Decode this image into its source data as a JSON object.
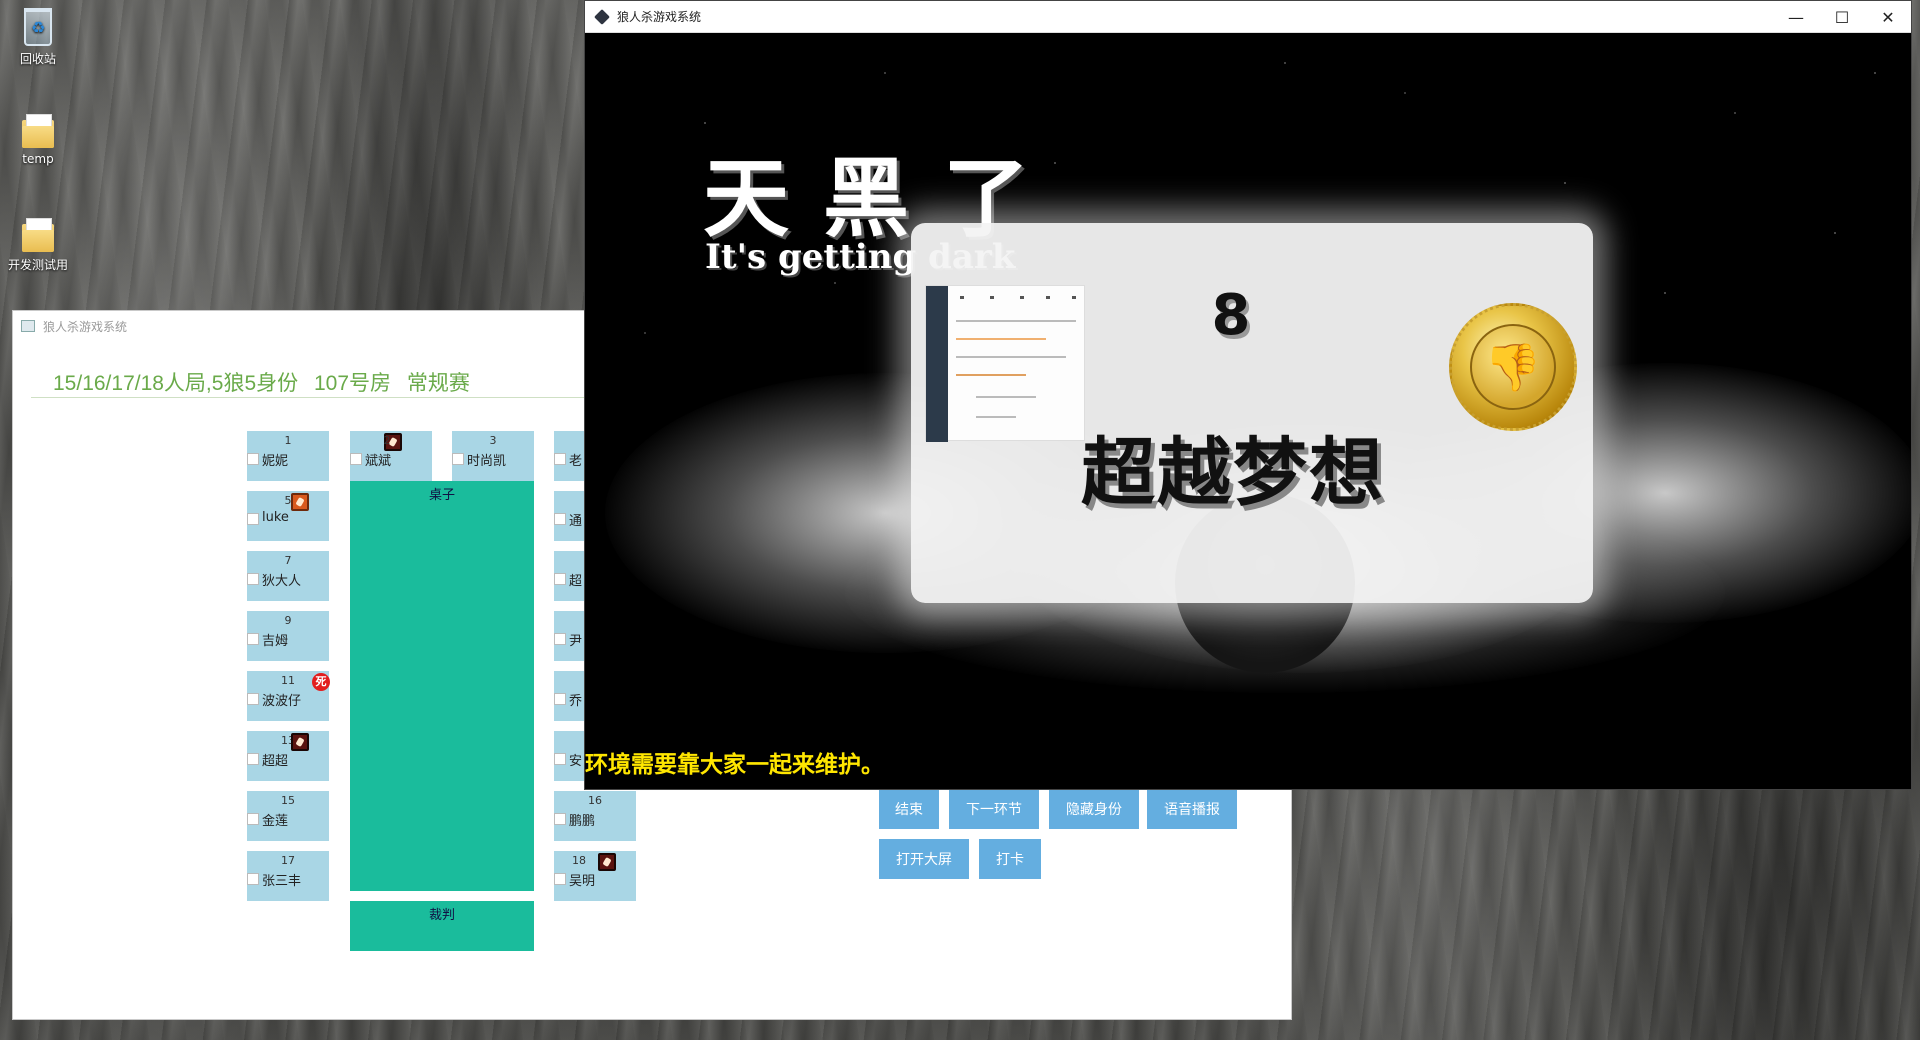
{
  "desktop": {
    "icons": [
      {
        "label": "回收站"
      },
      {
        "label": "temp"
      },
      {
        "label": "开发测试用"
      }
    ]
  },
  "admin_window": {
    "title": "狼人杀游戏系统",
    "game_info": "15/16/17/18人局,5狼5身份   107号房   常规赛",
    "table_label": "桌子",
    "judge_label": "裁判",
    "seats_left": [
      {
        "num": "1",
        "name": "妮妮"
      },
      {
        "num": "5",
        "name": "luke",
        "badge": "fire"
      },
      {
        "num": "7",
        "name": "狄大人"
      },
      {
        "num": "9",
        "name": "吉姆"
      },
      {
        "num": "11",
        "name": "波波仔",
        "dead": "死"
      },
      {
        "num": "13",
        "name": "超超",
        "badge": "role"
      },
      {
        "num": "15",
        "name": "金莲"
      },
      {
        "num": "17",
        "name": "张三丰"
      }
    ],
    "seats_top": [
      {
        "num": "2",
        "name": "斌斌",
        "badge": "role"
      },
      {
        "num": "3",
        "name": "时尚凯"
      }
    ],
    "seats_right_partial": [
      {
        "name": "老"
      },
      {
        "name": "通"
      },
      {
        "name": "超"
      },
      {
        "name": "尹"
      },
      {
        "name": "乔"
      },
      {
        "name": "安"
      },
      {
        "num": "16",
        "name": "鹏鹏"
      },
      {
        "num": "18",
        "name": "吴明",
        "badge": "role"
      }
    ],
    "buttons": {
      "end": "结束",
      "next_stage": "下一环节",
      "hide_identity": "隐藏身份",
      "voice_broadcast": "语音播报",
      "open_big_screen": "打开大屏",
      "check_in": "打卡"
    }
  },
  "night_window": {
    "title": "狼人杀游戏系统",
    "controls": {
      "minimize": "—",
      "maximize": "☐",
      "close": "✕"
    },
    "headline": "天黑了",
    "subtitle": "It's getting dark",
    "notice": "环境需要靠大家一起来维护。",
    "card": {
      "number": "8",
      "name": "超越梦想",
      "medal_icon": "thumbs-down-icon"
    }
  },
  "colors": {
    "seat": "#a9d6e5",
    "table": "#1abc9c",
    "button": "#64aee0",
    "info_text": "#6aaa4a",
    "notice": "#ffe600",
    "dead_badge": "#e21e1e"
  }
}
